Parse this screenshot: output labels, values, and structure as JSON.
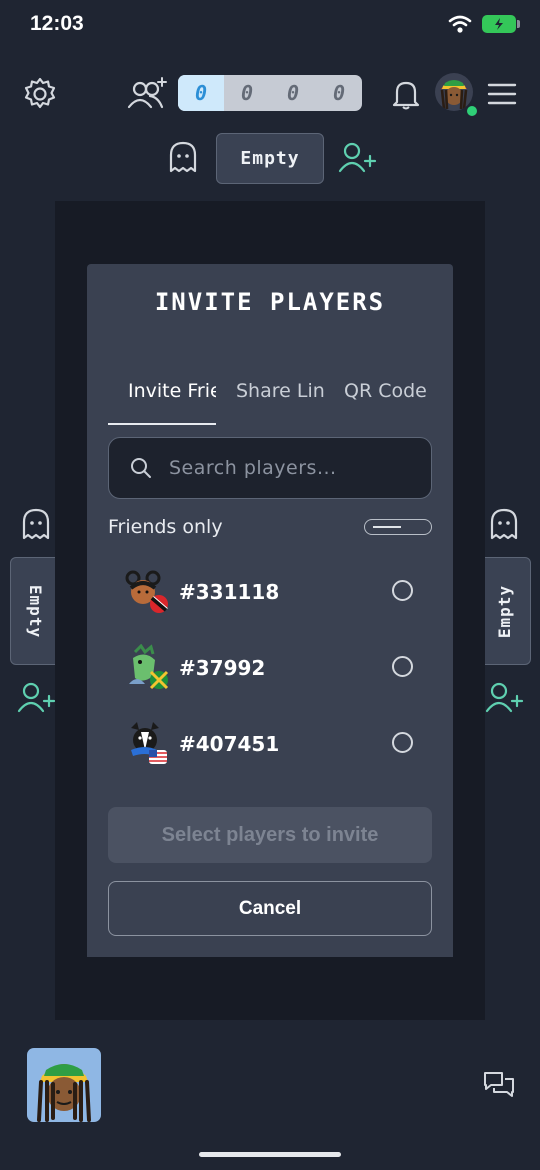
{
  "status_bar": {
    "time": "12:03"
  },
  "header": {
    "scores": [
      "0",
      "0",
      "0",
      "0"
    ],
    "top_seat_label": "Empty"
  },
  "seats": {
    "left_label": "Empty",
    "right_label": "Empty"
  },
  "modal": {
    "title": "INVITE PLAYERS",
    "tabs": [
      {
        "label": "Invite Friends"
      },
      {
        "label": "Share Link"
      },
      {
        "label": "QR Code"
      }
    ],
    "search_placeholder": "Search players...",
    "friends_only_label": "Friends only",
    "players": [
      {
        "name": "#331118"
      },
      {
        "name": "#37992"
      },
      {
        "name": "#407451"
      }
    ],
    "invite_button": "Select players to invite",
    "cancel_button": "Cancel"
  },
  "colors": {
    "accent": "#2c8fd6",
    "online": "#2fcf77",
    "icon_teal": "#5fd0b0"
  }
}
